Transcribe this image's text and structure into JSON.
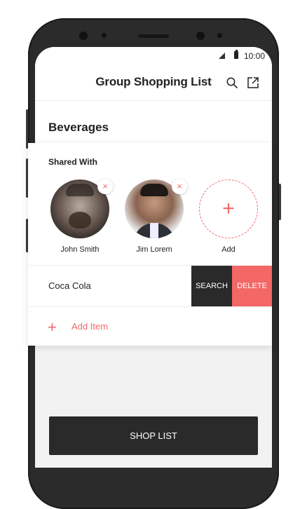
{
  "status": {
    "time": "10:00"
  },
  "header": {
    "title": "Group Shopping List"
  },
  "list": {
    "title": "Beverages"
  },
  "shared": {
    "label": "Shared With",
    "members": [
      {
        "name": "John Smith"
      },
      {
        "name": "Jim Lorem"
      }
    ],
    "add_label": "Add",
    "add_symbol": "+",
    "remove_symbol": "×"
  },
  "item": {
    "name": "Coca Cola",
    "search_label": "SEARCH",
    "delete_label": "DELETE"
  },
  "add_item": {
    "symbol": "+",
    "label": "Add Item"
  },
  "footer": {
    "shop_label": "SHOP LIST"
  },
  "colors": {
    "accent": "#f06a6a",
    "dark": "#2a2a2a",
    "delete": "#f36767"
  }
}
